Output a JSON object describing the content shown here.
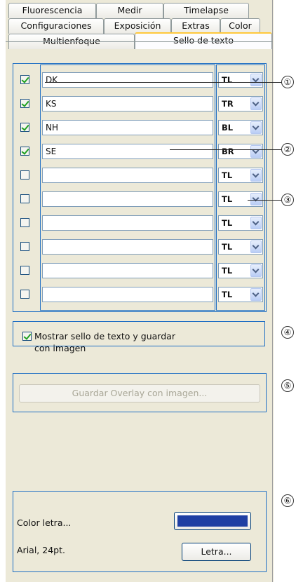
{
  "tabs": {
    "row1": [
      "Fluorescencia",
      "Medir",
      "Timelapse"
    ],
    "row2": [
      "Configuraciones",
      "Exposición",
      "Extras",
      "Color"
    ],
    "row3": [
      "Multienfoque",
      "Sello de texto"
    ],
    "active": "Sello de texto"
  },
  "stamps": [
    {
      "checked": true,
      "text": "DK",
      "position": "TL"
    },
    {
      "checked": true,
      "text": "KS",
      "position": "TR"
    },
    {
      "checked": true,
      "text": "NH",
      "position": "BL"
    },
    {
      "checked": true,
      "text": "SE",
      "position": "BR"
    },
    {
      "checked": false,
      "text": "",
      "position": "TL"
    },
    {
      "checked": false,
      "text": "",
      "position": "TL"
    },
    {
      "checked": false,
      "text": "",
      "position": "TL"
    },
    {
      "checked": false,
      "text": "",
      "position": "TL"
    },
    {
      "checked": false,
      "text": "",
      "position": "TL"
    },
    {
      "checked": false,
      "text": "",
      "position": "TL"
    }
  ],
  "show_stamp": {
    "checked": true,
    "label_line1": "Mostrar sello de texto y guardar",
    "label_line2": "con imagen"
  },
  "save_overlay_button": "Guardar Overlay con imagen...",
  "font": {
    "color_label": "Color letra...",
    "color_swatch": "#1f3fa3",
    "font_label": "Arial, 24pt.",
    "font_button": "Letra..."
  },
  "callouts": [
    "①",
    "②",
    "③",
    "④",
    "⑤",
    "⑥"
  ]
}
